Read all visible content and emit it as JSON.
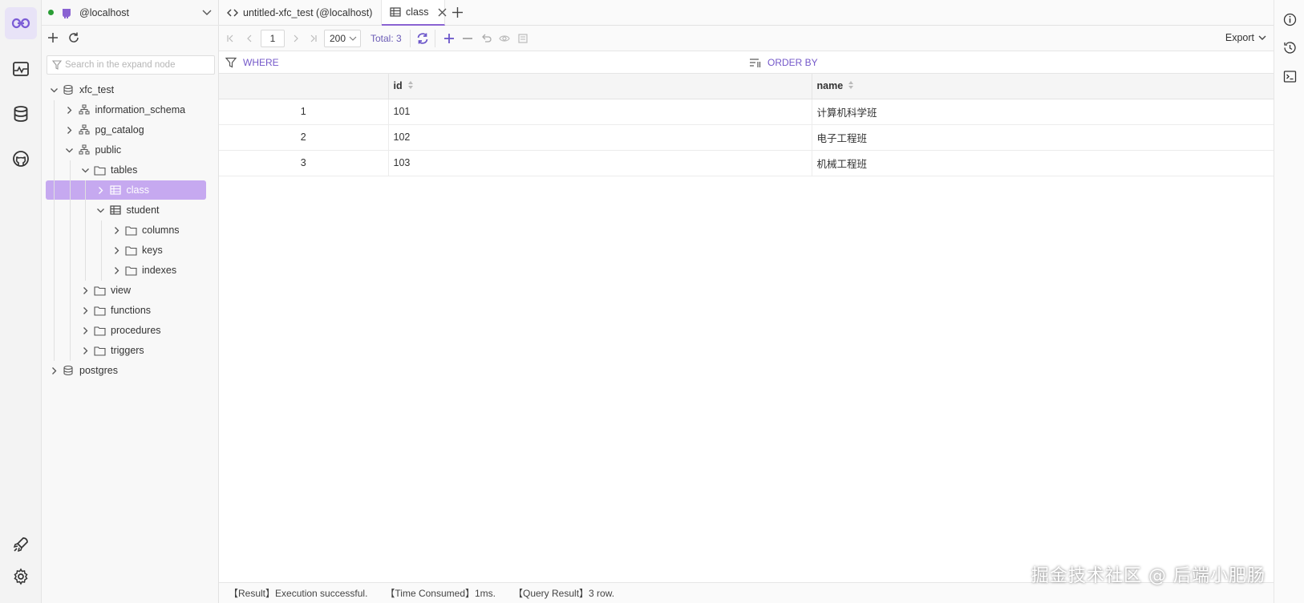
{
  "activity": {
    "items": [
      {
        "icon": "connection-icon",
        "active": true
      },
      {
        "icon": "monitor-icon",
        "active": false
      },
      {
        "icon": "database-icon",
        "active": false
      },
      {
        "icon": "github-icon",
        "active": false
      }
    ],
    "bottom": [
      "rocket-icon",
      "settings-gear-icon"
    ]
  },
  "explorer": {
    "connection": "@localhost",
    "search_placeholder": "Search in the expand node",
    "tree": [
      {
        "label": "xfc_test",
        "icon": "database-icon",
        "level": 0,
        "expanded": true
      },
      {
        "label": "information_schema",
        "icon": "schema-icon",
        "level": 1,
        "expanded": false
      },
      {
        "label": "pg_catalog",
        "icon": "schema-icon",
        "level": 1,
        "expanded": false
      },
      {
        "label": "public",
        "icon": "schema-icon",
        "level": 1,
        "expanded": true
      },
      {
        "label": "tables",
        "icon": "folder-icon",
        "level": 2,
        "expanded": true
      },
      {
        "label": "class",
        "icon": "table-icon",
        "level": 3,
        "expanded": false,
        "selected": true
      },
      {
        "label": "student",
        "icon": "table-icon",
        "level": 3,
        "expanded": true
      },
      {
        "label": "columns",
        "icon": "folder-icon",
        "level": 4,
        "expanded": false
      },
      {
        "label": "keys",
        "icon": "folder-icon",
        "level": 4,
        "expanded": false
      },
      {
        "label": "indexes",
        "icon": "folder-icon",
        "level": 4,
        "expanded": false
      },
      {
        "label": "view",
        "icon": "folder-icon",
        "level": 2,
        "expanded": false
      },
      {
        "label": "functions",
        "icon": "folder-icon",
        "level": 2,
        "expanded": false
      },
      {
        "label": "procedures",
        "icon": "folder-icon",
        "level": 2,
        "expanded": false
      },
      {
        "label": "triggers",
        "icon": "folder-icon",
        "level": 2,
        "expanded": false
      },
      {
        "label": "postgres",
        "icon": "database-icon",
        "level": 0,
        "expanded": false
      }
    ]
  },
  "tabs": [
    {
      "label": "untitled-xfc_test (@localhost)",
      "icon": "code-icon",
      "active": false
    },
    {
      "label": "class",
      "icon": "table-icon",
      "active": true
    }
  ],
  "toolbar": {
    "page": "1",
    "page_size": "200",
    "total": "Total: 3",
    "export": "Export"
  },
  "filter": {
    "where": "WHERE",
    "order_by": "ORDER BY"
  },
  "grid": {
    "columns": [
      "",
      "id",
      "name"
    ],
    "rows": [
      {
        "n": "1",
        "id": "101",
        "name": "计算机科学班"
      },
      {
        "n": "2",
        "id": "102",
        "name": "电子工程班"
      },
      {
        "n": "3",
        "id": "103",
        "name": "机械工程班"
      }
    ]
  },
  "status": {
    "result": "【Result】Execution successful.",
    "time": "【Time Consumed】1ms.",
    "query": "【Query Result】3 row."
  },
  "watermark": "掘金技术社区 @ 后端小肥肠",
  "colors": {
    "accent": "#8a63d2",
    "selected": "#c6a9f0"
  }
}
